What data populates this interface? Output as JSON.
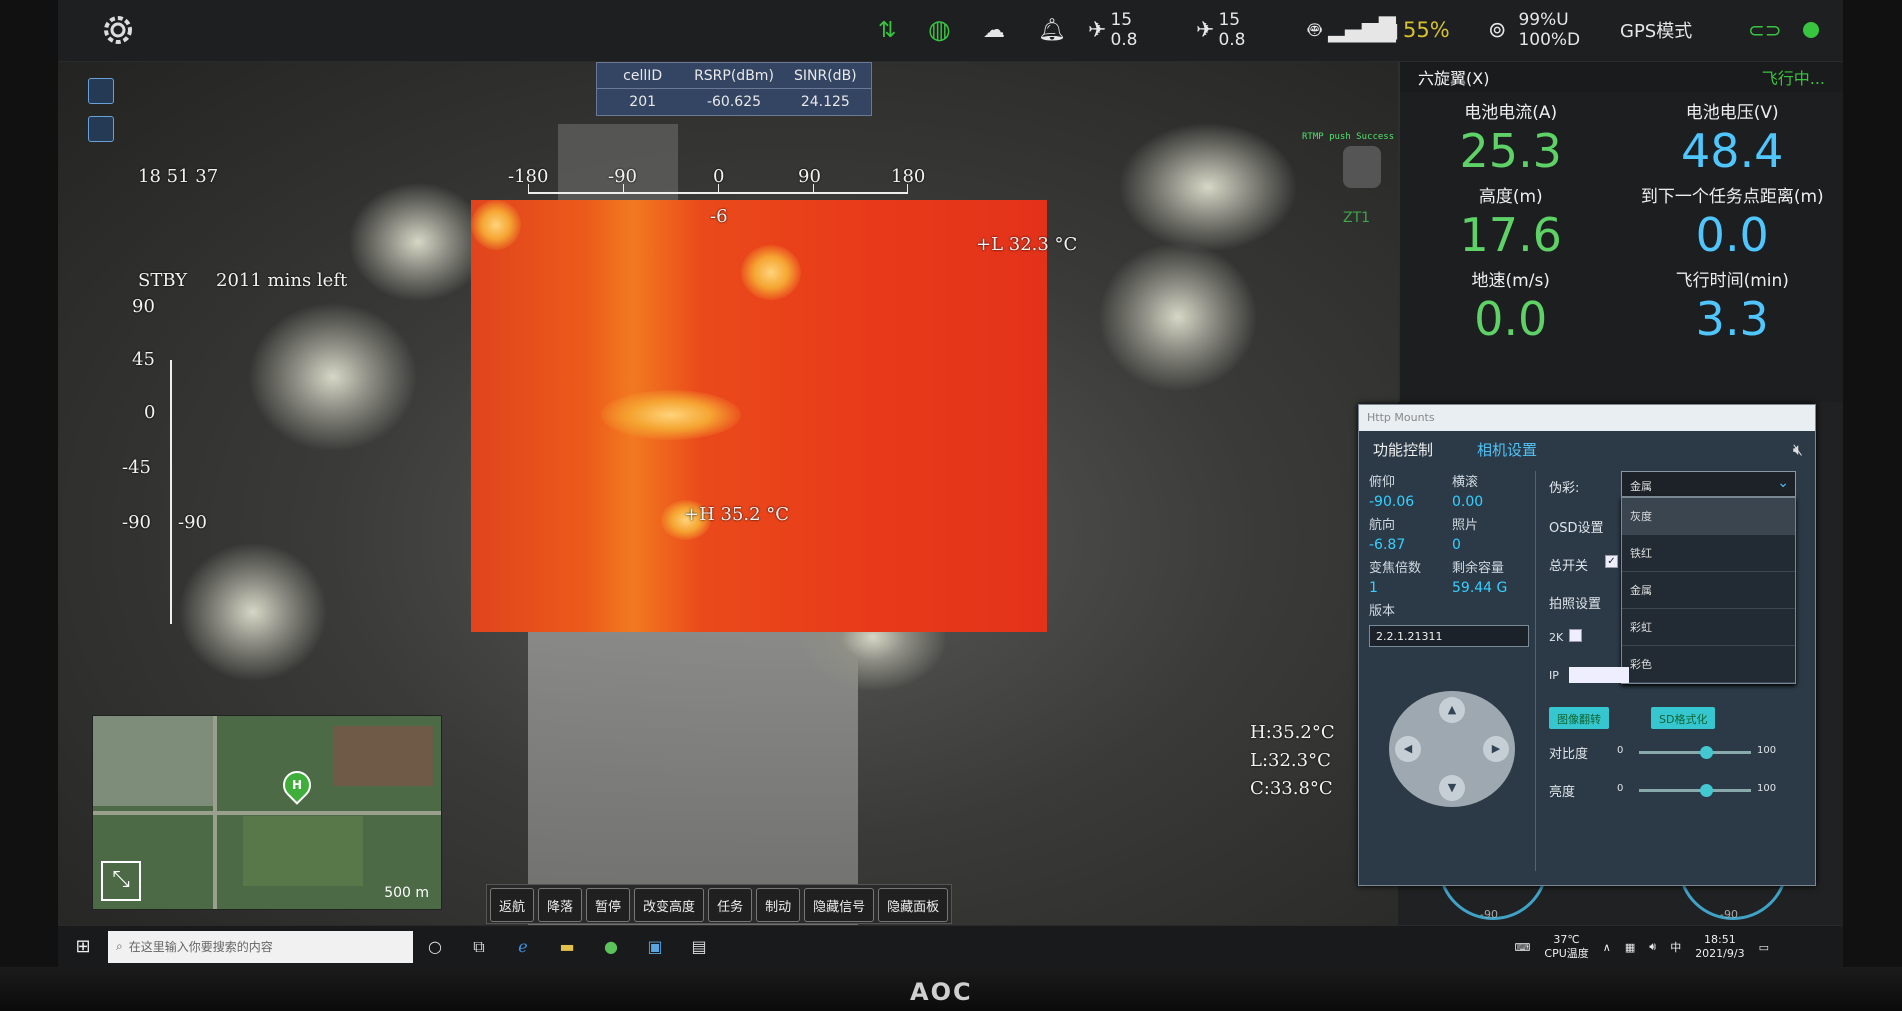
{
  "topbar": {
    "sat1_count": "15",
    "sat1_sub": "0.8",
    "sat2_count": "15",
    "sat2_sub": "0.8",
    "battery_pct": "55%",
    "link_up": "99%U",
    "link_down": "100%D",
    "mode": "GPS模式",
    "status_color": "#39c43f"
  },
  "osd": {
    "time": "18 51 37",
    "standby": "STBY",
    "mins_left": "2011 mins left",
    "top_scale": [
      "-180",
      "-90",
      "0",
      "90",
      "180"
    ],
    "heading_value": "-6",
    "left_scale": [
      "90",
      "45",
      "0",
      "-45",
      "-90"
    ],
    "left_bottom_extra": "-90",
    "temp_low_marker": "+L  32.3 °C",
    "temp_high_marker": "+H  35.2 °C",
    "stat_h": "H:35.2°C",
    "stat_l": "L:32.3°C",
    "stat_c": "C:33.8°C"
  },
  "cell_info": {
    "headers": [
      "cellID",
      "RSRP(dBm)",
      "SINR(dB)"
    ],
    "values": [
      "201",
      "-60.625",
      "24.125"
    ]
  },
  "rtmp": "RTMP push Success",
  "camera_label": "ZT1",
  "telemetry": {
    "aircraft": "六旋翼(X)",
    "status": "飞行中...",
    "items": [
      {
        "label": "电池电流(A)",
        "value": "25.3"
      },
      {
        "label": "电池电压(V)",
        "value": "48.4"
      },
      {
        "label": "高度(m)",
        "value": "17.6"
      },
      {
        "label": "到下一个任务点距离(m)",
        "value": "0.0"
      },
      {
        "label": "地速(m/s)",
        "value": "0.0"
      },
      {
        "label": "飞行时间(min)",
        "value": "3.3"
      }
    ]
  },
  "minimap": {
    "pin_label": "H",
    "scale": "500 m"
  },
  "controls": [
    "返航",
    "降落",
    "暂停",
    "改变高度",
    "任务",
    "制动",
    "隐藏信号",
    "隐藏面板"
  ],
  "mount": {
    "window_title": "Http Mounts",
    "tabs": [
      "功能控制",
      "相机设置"
    ],
    "left": {
      "pitch_label": "俯仰",
      "pitch_value": "-90.06",
      "roll_label": "横滚",
      "roll_value": "0.00",
      "yaw_label": "航向",
      "yaw_value": "-6.87",
      "photos_label": "照片",
      "photos_value": "0",
      "zoom_label": "变焦倍数",
      "zoom_value": "1",
      "capacity_label": "剩余容量",
      "capacity_value": "59.44 G",
      "version_label": "版本",
      "version_value": "2.2.1.21311"
    },
    "right": {
      "palette_label": "伪彩:",
      "palette_selected": "金属",
      "palette_options": [
        "灰度",
        "铁红",
        "金属",
        "彩虹",
        "彩色"
      ],
      "osd_label": "OSD设置",
      "master_label": "总开关",
      "photo_label": "拍照设置",
      "twok_label": "2K",
      "ip_label": "IP",
      "flip_button": "图像翻转",
      "format_button": "SD格式化",
      "contrast_label": "对比度",
      "contrast_min": "0",
      "contrast_max": "100",
      "contrast_level": 0.6,
      "brightness_label": "亮度",
      "brightness_min": "0",
      "brightness_max": "100",
      "brightness_level": 0.6
    }
  },
  "gauges": [
    "-90",
    "-90"
  ],
  "taskbar": {
    "search_placeholder": "在这里输入你要搜索的内容",
    "cpu_temp": "37℃",
    "cpu_label": "CPU温度",
    "time": "18:51",
    "date": "2021/9/3"
  },
  "brand": "AOC"
}
